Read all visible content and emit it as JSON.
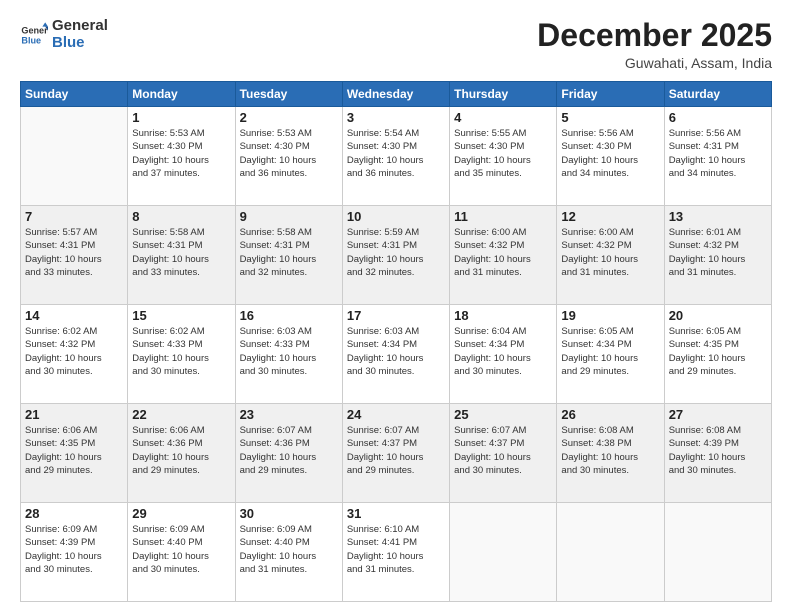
{
  "header": {
    "logo_line1": "General",
    "logo_line2": "Blue",
    "month_year": "December 2025",
    "location": "Guwahati, Assam, India"
  },
  "weekdays": [
    "Sunday",
    "Monday",
    "Tuesday",
    "Wednesday",
    "Thursday",
    "Friday",
    "Saturday"
  ],
  "weeks": [
    [
      {
        "day": "",
        "info": ""
      },
      {
        "day": "1",
        "info": "Sunrise: 5:53 AM\nSunset: 4:30 PM\nDaylight: 10 hours\nand 37 minutes."
      },
      {
        "day": "2",
        "info": "Sunrise: 5:53 AM\nSunset: 4:30 PM\nDaylight: 10 hours\nand 36 minutes."
      },
      {
        "day": "3",
        "info": "Sunrise: 5:54 AM\nSunset: 4:30 PM\nDaylight: 10 hours\nand 36 minutes."
      },
      {
        "day": "4",
        "info": "Sunrise: 5:55 AM\nSunset: 4:30 PM\nDaylight: 10 hours\nand 35 minutes."
      },
      {
        "day": "5",
        "info": "Sunrise: 5:56 AM\nSunset: 4:30 PM\nDaylight: 10 hours\nand 34 minutes."
      },
      {
        "day": "6",
        "info": "Sunrise: 5:56 AM\nSunset: 4:31 PM\nDaylight: 10 hours\nand 34 minutes."
      }
    ],
    [
      {
        "day": "7",
        "info": "Sunrise: 5:57 AM\nSunset: 4:31 PM\nDaylight: 10 hours\nand 33 minutes."
      },
      {
        "day": "8",
        "info": "Sunrise: 5:58 AM\nSunset: 4:31 PM\nDaylight: 10 hours\nand 33 minutes."
      },
      {
        "day": "9",
        "info": "Sunrise: 5:58 AM\nSunset: 4:31 PM\nDaylight: 10 hours\nand 32 minutes."
      },
      {
        "day": "10",
        "info": "Sunrise: 5:59 AM\nSunset: 4:31 PM\nDaylight: 10 hours\nand 32 minutes."
      },
      {
        "day": "11",
        "info": "Sunrise: 6:00 AM\nSunset: 4:32 PM\nDaylight: 10 hours\nand 31 minutes."
      },
      {
        "day": "12",
        "info": "Sunrise: 6:00 AM\nSunset: 4:32 PM\nDaylight: 10 hours\nand 31 minutes."
      },
      {
        "day": "13",
        "info": "Sunrise: 6:01 AM\nSunset: 4:32 PM\nDaylight: 10 hours\nand 31 minutes."
      }
    ],
    [
      {
        "day": "14",
        "info": "Sunrise: 6:02 AM\nSunset: 4:32 PM\nDaylight: 10 hours\nand 30 minutes."
      },
      {
        "day": "15",
        "info": "Sunrise: 6:02 AM\nSunset: 4:33 PM\nDaylight: 10 hours\nand 30 minutes."
      },
      {
        "day": "16",
        "info": "Sunrise: 6:03 AM\nSunset: 4:33 PM\nDaylight: 10 hours\nand 30 minutes."
      },
      {
        "day": "17",
        "info": "Sunrise: 6:03 AM\nSunset: 4:34 PM\nDaylight: 10 hours\nand 30 minutes."
      },
      {
        "day": "18",
        "info": "Sunrise: 6:04 AM\nSunset: 4:34 PM\nDaylight: 10 hours\nand 30 minutes."
      },
      {
        "day": "19",
        "info": "Sunrise: 6:05 AM\nSunset: 4:34 PM\nDaylight: 10 hours\nand 29 minutes."
      },
      {
        "day": "20",
        "info": "Sunrise: 6:05 AM\nSunset: 4:35 PM\nDaylight: 10 hours\nand 29 minutes."
      }
    ],
    [
      {
        "day": "21",
        "info": "Sunrise: 6:06 AM\nSunset: 4:35 PM\nDaylight: 10 hours\nand 29 minutes."
      },
      {
        "day": "22",
        "info": "Sunrise: 6:06 AM\nSunset: 4:36 PM\nDaylight: 10 hours\nand 29 minutes."
      },
      {
        "day": "23",
        "info": "Sunrise: 6:07 AM\nSunset: 4:36 PM\nDaylight: 10 hours\nand 29 minutes."
      },
      {
        "day": "24",
        "info": "Sunrise: 6:07 AM\nSunset: 4:37 PM\nDaylight: 10 hours\nand 29 minutes."
      },
      {
        "day": "25",
        "info": "Sunrise: 6:07 AM\nSunset: 4:37 PM\nDaylight: 10 hours\nand 30 minutes."
      },
      {
        "day": "26",
        "info": "Sunrise: 6:08 AM\nSunset: 4:38 PM\nDaylight: 10 hours\nand 30 minutes."
      },
      {
        "day": "27",
        "info": "Sunrise: 6:08 AM\nSunset: 4:39 PM\nDaylight: 10 hours\nand 30 minutes."
      }
    ],
    [
      {
        "day": "28",
        "info": "Sunrise: 6:09 AM\nSunset: 4:39 PM\nDaylight: 10 hours\nand 30 minutes."
      },
      {
        "day": "29",
        "info": "Sunrise: 6:09 AM\nSunset: 4:40 PM\nDaylight: 10 hours\nand 30 minutes."
      },
      {
        "day": "30",
        "info": "Sunrise: 6:09 AM\nSunset: 4:40 PM\nDaylight: 10 hours\nand 31 minutes."
      },
      {
        "day": "31",
        "info": "Sunrise: 6:10 AM\nSunset: 4:41 PM\nDaylight: 10 hours\nand 31 minutes."
      },
      {
        "day": "",
        "info": ""
      },
      {
        "day": "",
        "info": ""
      },
      {
        "day": "",
        "info": ""
      }
    ]
  ]
}
